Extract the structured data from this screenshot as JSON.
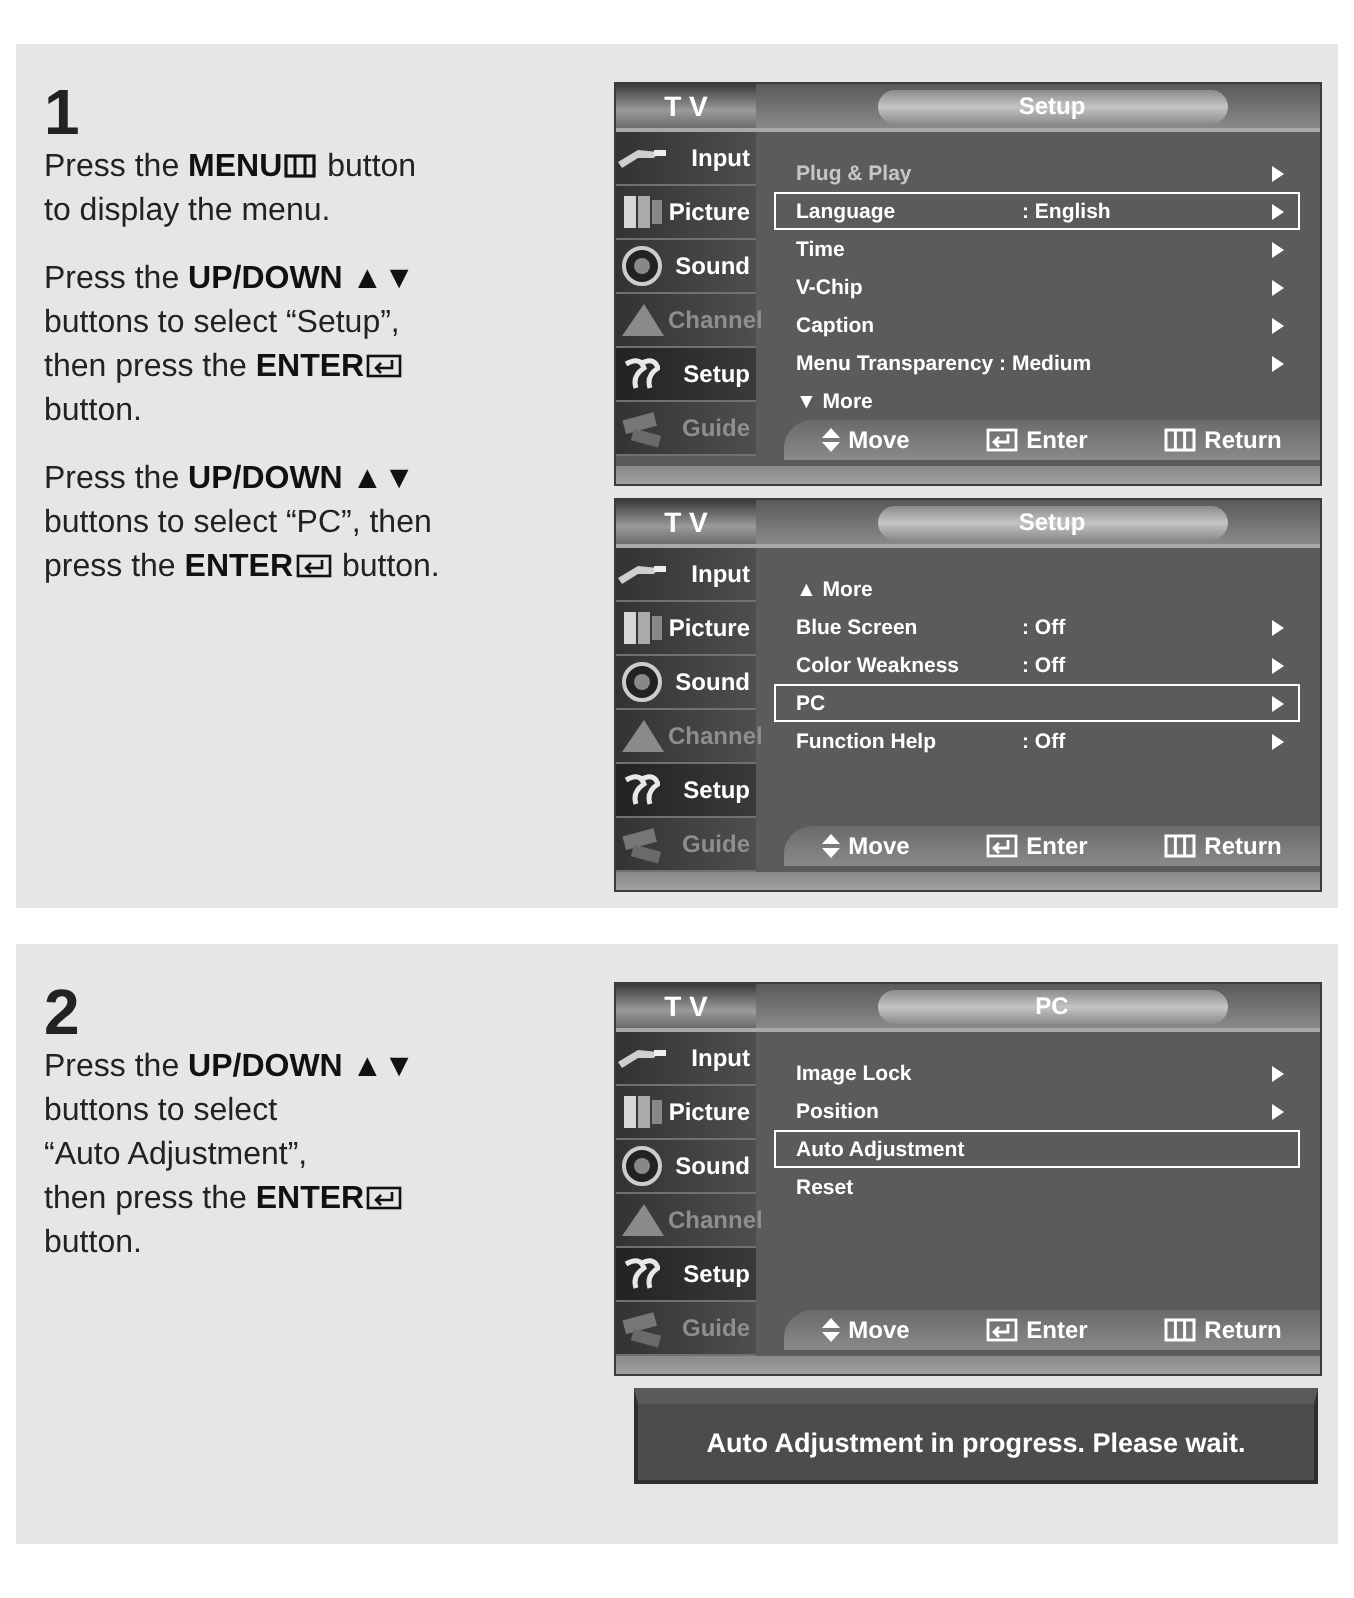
{
  "steps": [
    {
      "number": "1",
      "paragraphs": [
        [
          [
            {
              "kind": "text",
              "text": "Press the **MENU**"
            },
            {
              "kind": "menu_key"
            },
            {
              "kind": "text",
              "text": " button"
            }
          ],
          [
            {
              "kind": "text",
              "text": "to display the menu."
            }
          ]
        ],
        [
          [
            {
              "kind": "text",
              "text": "Press the **UP/DOWN ▲▼**"
            }
          ],
          [
            {
              "kind": "text",
              "text": "buttons to select “Setup”,"
            }
          ],
          [
            {
              "kind": "text",
              "text": "then press the **ENTER**"
            },
            {
              "kind": "enter_key"
            }
          ],
          [
            {
              "kind": "text",
              "text": "button."
            }
          ]
        ],
        [
          [
            {
              "kind": "text",
              "text": "Press the **UP/DOWN ▲▼**"
            }
          ],
          [
            {
              "kind": "text",
              "text": "buttons to select “PC”, then"
            }
          ],
          [
            {
              "kind": "text",
              "text": "press the **ENTER**"
            },
            {
              "kind": "enter_key"
            },
            {
              "kind": "text",
              "text": " button."
            }
          ]
        ]
      ],
      "screens": [
        {
          "brand": "T V",
          "title": "Setup",
          "sidebar": [
            {
              "label": "Input",
              "selected": false,
              "disabled": false
            },
            {
              "label": "Picture",
              "selected": false,
              "disabled": false
            },
            {
              "label": "Sound",
              "selected": false,
              "disabled": false
            },
            {
              "label": "Channel",
              "selected": false,
              "disabled": true
            },
            {
              "label": "Setup",
              "selected": true,
              "disabled": false
            },
            {
              "label": "Guide",
              "selected": false,
              "disabled": true
            }
          ],
          "rows": [
            {
              "label": "Plug & Play",
              "arrow": true,
              "selected": false,
              "disabled": true
            },
            {
              "label": "Language",
              "value": ": English",
              "arrow": true,
              "selected": true,
              "disabled": false
            },
            {
              "label": "Time",
              "arrow": true,
              "selected": false,
              "disabled": false
            },
            {
              "label": "V-Chip",
              "arrow": true,
              "selected": false,
              "disabled": false
            },
            {
              "label": "Caption",
              "arrow": true,
              "selected": false,
              "disabled": false
            },
            {
              "label": "Menu Transparency : Medium",
              "arrow": true,
              "selected": false,
              "disabled": false
            },
            {
              "label": "▼ More",
              "arrow": false,
              "selected": false,
              "disabled": false
            }
          ],
          "footer": [
            {
              "kind": "move",
              "label": "Move"
            },
            {
              "kind": "enter",
              "label": "Enter"
            },
            {
              "kind": "return",
              "label": "Return"
            }
          ]
        },
        {
          "brand": "T V",
          "title": "Setup",
          "sidebar": [
            {
              "label": "Input",
              "selected": false,
              "disabled": false
            },
            {
              "label": "Picture",
              "selected": false,
              "disabled": false
            },
            {
              "label": "Sound",
              "selected": false,
              "disabled": false
            },
            {
              "label": "Channel",
              "selected": false,
              "disabled": true
            },
            {
              "label": "Setup",
              "selected": true,
              "disabled": false
            },
            {
              "label": "Guide",
              "selected": false,
              "disabled": true
            }
          ],
          "rows": [
            {
              "label": "▲ More",
              "arrow": false,
              "selected": false,
              "disabled": false
            },
            {
              "label": "Blue Screen",
              "value": ": Off",
              "arrow": true,
              "selected": false,
              "disabled": false
            },
            {
              "label": "Color Weakness",
              "value": ": Off",
              "arrow": true,
              "selected": false,
              "disabled": false
            },
            {
              "label": "PC",
              "arrow": true,
              "selected": true,
              "disabled": false
            },
            {
              "label": "Function Help",
              "value": ": Off",
              "arrow": true,
              "selected": false,
              "disabled": false
            }
          ],
          "footer": [
            {
              "kind": "move",
              "label": "Move"
            },
            {
              "kind": "enter",
              "label": "Enter"
            },
            {
              "kind": "return",
              "label": "Return"
            }
          ]
        }
      ]
    },
    {
      "number": "2",
      "paragraphs": [
        [
          [
            {
              "kind": "text",
              "text": "Press the **UP/DOWN ▲▼**"
            }
          ],
          [
            {
              "kind": "text",
              "text": "buttons to select"
            }
          ],
          [
            {
              "kind": "text",
              "text": "“Auto Adjustment”,"
            }
          ],
          [
            {
              "kind": "text",
              "text": "then press the **ENTER**"
            },
            {
              "kind": "enter_key"
            }
          ],
          [
            {
              "kind": "text",
              "text": "button."
            }
          ]
        ]
      ],
      "screens": [
        {
          "brand": "T V",
          "title": "PC",
          "sidebar": [
            {
              "label": "Input",
              "selected": false,
              "disabled": false
            },
            {
              "label": "Picture",
              "selected": false,
              "disabled": false
            },
            {
              "label": "Sound",
              "selected": false,
              "disabled": false
            },
            {
              "label": "Channel",
              "selected": false,
              "disabled": true
            },
            {
              "label": "Setup",
              "selected": true,
              "disabled": false
            },
            {
              "label": "Guide",
              "selected": false,
              "disabled": true
            }
          ],
          "rows": [
            {
              "label": "Image Lock",
              "arrow": true,
              "selected": false,
              "disabled": false
            },
            {
              "label": "Position",
              "arrow": true,
              "selected": false,
              "disabled": false
            },
            {
              "label": "Auto Adjustment",
              "arrow": false,
              "selected": true,
              "disabled": false
            },
            {
              "label": "Reset",
              "arrow": false,
              "selected": false,
              "disabled": false
            }
          ],
          "footer": [
            {
              "kind": "move",
              "label": "Move"
            },
            {
              "kind": "enter",
              "label": "Enter"
            },
            {
              "kind": "return",
              "label": "Return"
            }
          ]
        }
      ],
      "message": "Auto Adjustment in progress. Please wait."
    }
  ]
}
